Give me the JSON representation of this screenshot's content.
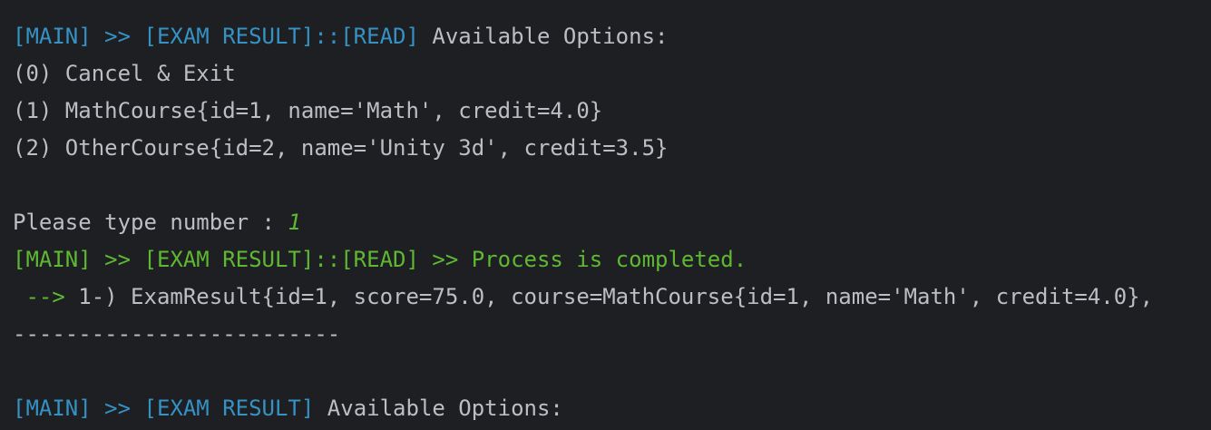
{
  "colors": {
    "background": "#1e1f22",
    "text": "#bcbec4",
    "prefix_blue": "#3592c4",
    "success_green": "#5fb832"
  },
  "console": {
    "lines": [
      {
        "prefix": "[MAIN] >> [EXAM RESULT]::[READ]",
        "text": " Available Options:"
      },
      {
        "text": "(0) Cancel & Exit"
      },
      {
        "text": "(1) MathCourse{id=1, name='Math', credit=4.0}"
      },
      {
        "text": "(2) OtherCourse{id=2, name='Unity 3d', credit=3.5}"
      },
      {
        "text": ""
      },
      {
        "prompt": "Please type number : ",
        "input": "1"
      },
      {
        "prefix": "[MAIN] >> [EXAM RESULT]::[READ] >> Process is completed."
      },
      {
        "arrow": " -->",
        "text": " 1-) ExamResult{id=1, score=75.0, course=MathCourse{id=1, name='Math', credit=4.0},"
      },
      {
        "text": "-------------------------"
      },
      {
        "text": ""
      },
      {
        "prefix": "[MAIN] >> [EXAM RESULT]",
        "text": " Available Options:"
      }
    ]
  }
}
